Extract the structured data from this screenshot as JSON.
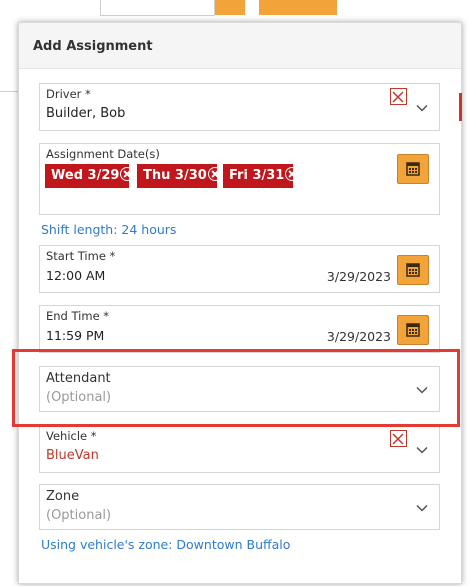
{
  "modal": {
    "title": "Add Assignment"
  },
  "driver": {
    "label": "Driver *",
    "value": "Builder, Bob"
  },
  "assignment_dates": {
    "label": "Assignment Date(s)",
    "chips": [
      "Wed 3/29",
      "Thu 3/30",
      "Fri 3/31"
    ]
  },
  "shift_length": "Shift length: 24 hours",
  "start_time": {
    "label": "Start Time *",
    "time": "12:00 AM",
    "date": "3/29/2023"
  },
  "end_time": {
    "label": "End Time *",
    "time": "11:59 PM",
    "date": "3/29/2023"
  },
  "attendant": {
    "label": "Attendant",
    "placeholder": "(Optional)"
  },
  "vehicle": {
    "label": "Vehicle *",
    "value": "BlueVan"
  },
  "zone": {
    "label": "Zone",
    "placeholder": "(Optional)"
  },
  "zone_note": "Using vehicle's zone: Downtown Buffalo",
  "colors": {
    "accent_orange": "#f2a33a",
    "chip_red": "#c0161c",
    "link_blue": "#2e7bcf",
    "highlight_red": "#e53935"
  },
  "icons": [
    "calendar-icon",
    "chevron-down-icon",
    "clear-icon",
    "chip-remove-icon"
  ]
}
